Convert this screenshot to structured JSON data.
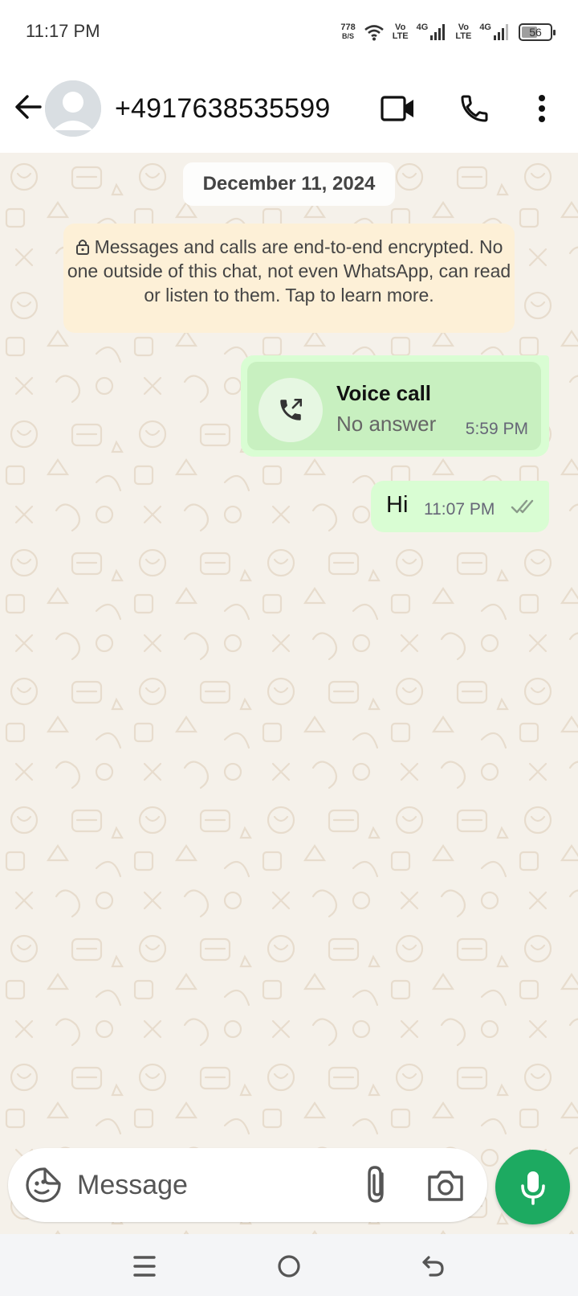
{
  "status_bar": {
    "time": "11:17 PM",
    "net_rate": "778",
    "net_rate_unit": "B/S",
    "sim1_vo": "Vo",
    "sim1_lte": "LTE",
    "sim1_gen": "4G",
    "sim2_vo": "Vo",
    "sim2_lte": "LTE",
    "sim2_gen": "4G",
    "battery_level": "56",
    "battery_fraction": 0.56
  },
  "header": {
    "contact": "+4917638535599",
    "icons": [
      "back-arrow-icon",
      "avatar-icon",
      "video-call-icon",
      "phone-call-icon",
      "more-vert-icon"
    ]
  },
  "chat": {
    "date_chip": "December 11, 2024",
    "encryption_notice": "Messages and calls are end-to-end encrypted. No one outside of this chat, not even WhatsApp, can read or listen to them. Tap to learn more.",
    "messages": [
      {
        "type": "call",
        "title": "Voice call",
        "subtitle": "No answer",
        "time": "5:59 PM",
        "icon": "missed-outgoing-call-icon"
      },
      {
        "type": "text",
        "text": "Hi",
        "time": "11:07 PM",
        "status": "delivered-double-tick"
      }
    ]
  },
  "composer": {
    "placeholder": "Message",
    "icons": [
      "sticker-icon",
      "attach-icon",
      "camera-icon",
      "mic-icon"
    ]
  },
  "colors": {
    "outgoing_bubble": "#d9fdd3",
    "chat_background": "#f5f1ea",
    "encryption_notice_bg": "#fdf0d7",
    "mic_button": "#1daa61"
  }
}
